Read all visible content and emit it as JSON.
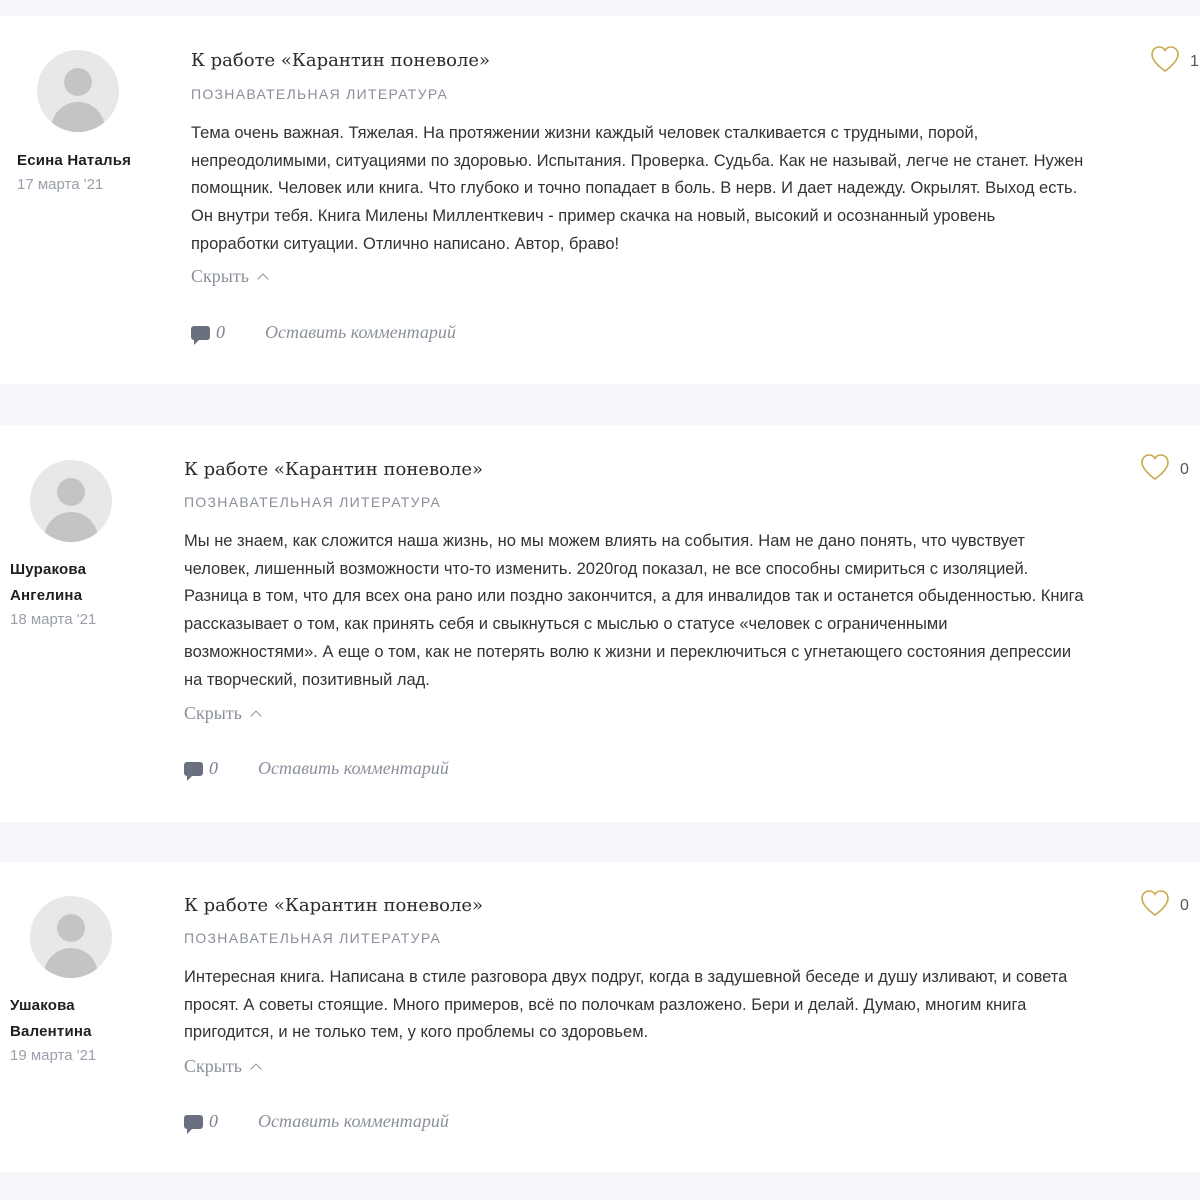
{
  "reviews": [
    {
      "author": "Есина Наталья",
      "date": "17 марта '21",
      "work_title": "К работе «Карантин поневоле»",
      "genre": "ПОЗНАВАТЕЛЬНАЯ ЛИТЕРАТУРА",
      "text": [
        "Тема очень важная. Тяжелая. На протяжении жизни каждый человек сталкивается с трудными, порой,",
        "непреодолимыми, ситуациями по здоровью. Испытания. Проверка. Судьба. Как не называй, легче не станет. Нужен",
        "помощник. Человек или книга. Что глубоко и точно попадает в боль. В нерв. И дает надежду. Окрылят. Выход есть.",
        "Он внутри тебя. Книга Милены Милленткевич - пример скачка на новый, высокий и осознанный уровень",
        "проработки ситуации. Отлично написано. Автор, браво!"
      ],
      "hide_label": "Скрыть",
      "comment_count": "0",
      "leave_comment": "Оставить комментарий",
      "likes": "1"
    },
    {
      "author": "Шуракова Ангелина",
      "date": "18 марта '21",
      "work_title": "К работе «Карантин поневоле»",
      "genre": "ПОЗНАВАТЕЛЬНАЯ ЛИТЕРАТУРА",
      "text": [
        "Мы не знаем, как сложится наша жизнь, но мы можем влиять на события. Нам не дано понять, что чувствует",
        "человек, лишенный возможности что-то изменить. 2020год показал, не все способны смириться с изоляцией.",
        "Разница в том, что для всех она рано или поздно закончится, а для инвалидов так и останется обыденностью. Книга",
        "рассказывает о том, как принять себя и свыкнуться с мыслью о статусе «человек с ограниченными",
        "возможностями». А еще о том, как не потерять волю к жизни и переключиться с угнетающего состояния депрессии",
        "на творческий, позитивный лад."
      ],
      "hide_label": "Скрыть",
      "comment_count": "0",
      "leave_comment": "Оставить комментарий",
      "likes": "0"
    },
    {
      "author": "Ушакова Валентина",
      "date": "19 марта '21",
      "work_title": "К работе «Карантин поневоле»",
      "genre": "ПОЗНАВАТЕЛЬНАЯ ЛИТЕРАТУРА",
      "text": [
        "Интересная книга. Написана в стиле разговора двух подруг, когда в задушевной беседе и душу изливают, и совета",
        "просят. А советы стоящие. Много примеров, всё по полочкам разложено. Бери и делай. Думаю, многим книга",
        "пригодится, и не только тем, у кого проблемы со здоровьем."
      ],
      "hide_label": "Скрыть",
      "comment_count": "0",
      "leave_comment": "Оставить комментарий",
      "likes": "0"
    }
  ],
  "colors": {
    "background": "#f4f6fa",
    "card": "#ffffff",
    "heart": "#c9a84c",
    "muted": "#8a8f9c"
  },
  "icons": [
    "user-avatar-icon",
    "chevron-up-icon",
    "comment-bubble-icon",
    "heart-icon"
  ]
}
